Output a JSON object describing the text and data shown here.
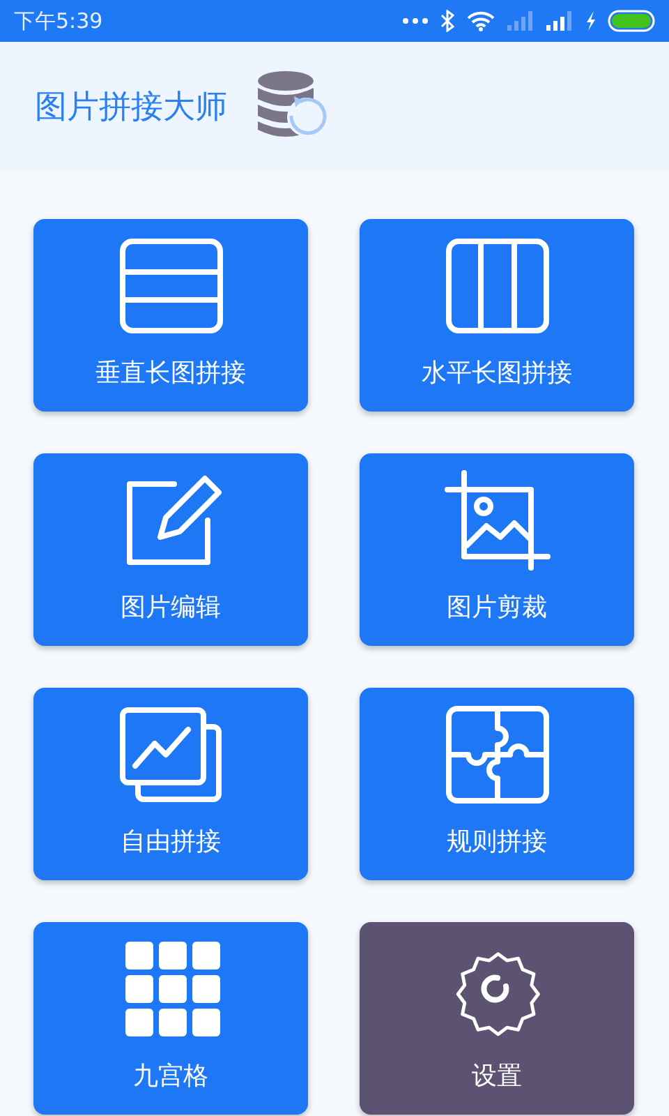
{
  "status_bar": {
    "time": "下午5:39"
  },
  "header": {
    "title": "图片拼接大师"
  },
  "tiles": [
    {
      "kind": "vertical",
      "label": "垂直长图拼接",
      "pressed": false
    },
    {
      "kind": "horizontal",
      "label": "水平长图拼接",
      "pressed": false
    },
    {
      "kind": "edit",
      "label": "图片编辑",
      "pressed": false
    },
    {
      "kind": "crop",
      "label": "图片剪裁",
      "pressed": false
    },
    {
      "kind": "free",
      "label": "自由拼接",
      "pressed": false
    },
    {
      "kind": "puzzle",
      "label": "规则拼接",
      "pressed": false
    },
    {
      "kind": "grid",
      "label": "九宫格",
      "pressed": false
    },
    {
      "kind": "settings",
      "label": "设置",
      "pressed": true
    }
  ]
}
